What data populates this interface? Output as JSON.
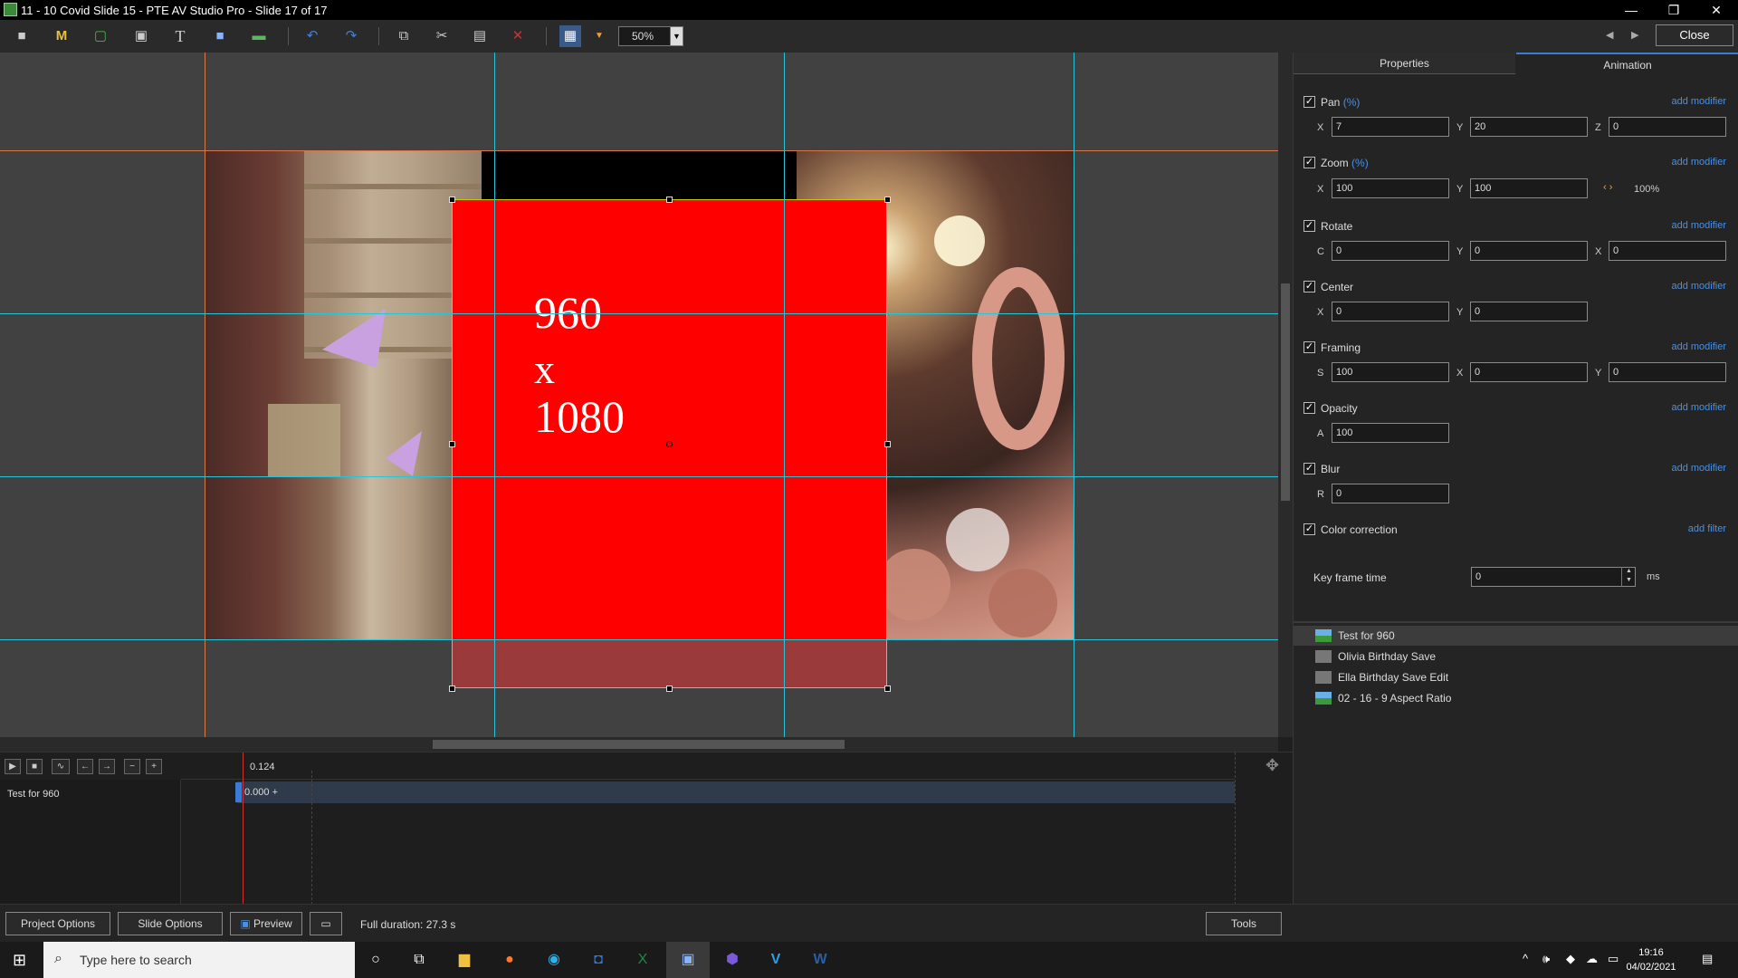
{
  "window": {
    "title": "11 - 10 Covid Slide 15 - PTE AV Studio Pro - Slide 17 of 17",
    "minimize": "—",
    "restore": "❐",
    "close": "✕"
  },
  "toolbar": {
    "zoom_value": "50%",
    "close_label": "Close",
    "icons": [
      "camera-icon",
      "mask-icon",
      "frame-icon",
      "video-icon",
      "text-icon",
      "rectangle-icon",
      "image-icon",
      "undo-icon",
      "redo-icon",
      "copy-icon",
      "cut-icon",
      "paste-icon",
      "delete-icon",
      "grid-icon",
      "dropdown-icon"
    ]
  },
  "canvas": {
    "line1": "960",
    "line2": "x",
    "line3": "1080"
  },
  "panel": {
    "tabs": [
      "Properties",
      "Animation"
    ],
    "active_tab": "Animation",
    "pan": {
      "label": "Pan",
      "unit": "(%)",
      "add": "add modifier",
      "x_label": "X",
      "x": "7",
      "y_label": "Y",
      "y": "20",
      "z_label": "Z",
      "z": "0"
    },
    "zoom": {
      "label": "Zoom",
      "unit": "(%)",
      "add": "add modifier",
      "x_label": "X",
      "x": "100",
      "y_label": "Y",
      "y": "100",
      "percent": "100%"
    },
    "rotate": {
      "label": "Rotate",
      "add": "add modifier",
      "c_label": "C",
      "c": "0",
      "y_label": "Y",
      "y": "0",
      "x_label": "X",
      "x": "0"
    },
    "center": {
      "label": "Center",
      "add": "add modifier",
      "x_label": "X",
      "x": "0",
      "y_label": "Y",
      "y": "0"
    },
    "framing": {
      "label": "Framing",
      "add": "add modifier",
      "s_label": "S",
      "s": "100",
      "x_label": "X",
      "x": "0",
      "y_label": "Y",
      "y": "0"
    },
    "opacity": {
      "label": "Opacity",
      "add": "add modifier",
      "a_label": "A",
      "a": "100"
    },
    "blur": {
      "label": "Blur",
      "add": "add modifier",
      "r_label": "R",
      "r": "0"
    },
    "color_correction": {
      "label": "Color correction",
      "add": "add filter"
    },
    "keyframe": {
      "label": "Key frame time",
      "value": "0",
      "unit": "ms"
    },
    "objects": [
      "Test for 960",
      "Olivia Birthday Save",
      "Ella Birthday Save Edit",
      "02 - 16 - 9 Aspect Ratio"
    ]
  },
  "timeline": {
    "time": "0.124",
    "track_label": "Test for 960",
    "key_text": "0.000 +",
    "buttons": [
      "play-icon",
      "stop-icon",
      "waveform-icon",
      "prev-icon",
      "next-icon",
      "zoom-out-icon",
      "zoom-in-icon"
    ]
  },
  "bottom": {
    "project_options": "Project Options",
    "slide_options": "Slide Options",
    "preview": "Preview",
    "duration": "Full duration: 27.3 s",
    "tools": "Tools"
  },
  "taskbar": {
    "search_placeholder": "Type here to search",
    "time": "19:16",
    "date": "04/02/2021"
  },
  "colors": {
    "accent": "#3a7bd5",
    "link": "#4a90e2",
    "guide": "#29c4d8",
    "red_object": "#ff0000"
  }
}
